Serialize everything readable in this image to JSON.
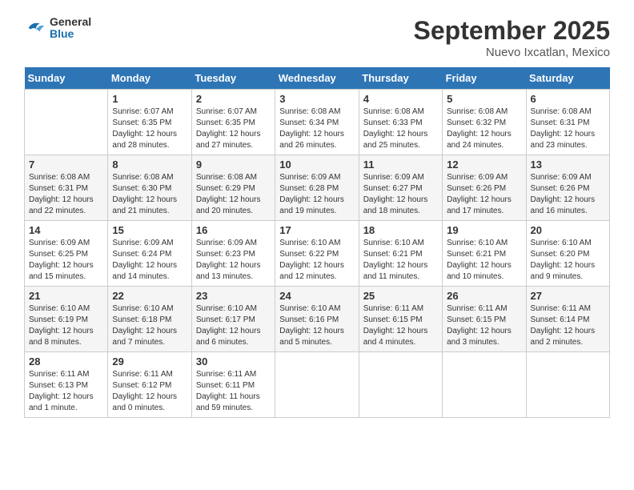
{
  "header": {
    "title": "September 2025",
    "subtitle": "Nuevo Ixcatlan, Mexico",
    "logo_general": "General",
    "logo_blue": "Blue"
  },
  "days_of_week": [
    "Sunday",
    "Monday",
    "Tuesday",
    "Wednesday",
    "Thursday",
    "Friday",
    "Saturday"
  ],
  "weeks": [
    [
      {
        "num": "",
        "info": ""
      },
      {
        "num": "1",
        "info": "Sunrise: 6:07 AM\nSunset: 6:35 PM\nDaylight: 12 hours\nand 28 minutes."
      },
      {
        "num": "2",
        "info": "Sunrise: 6:07 AM\nSunset: 6:35 PM\nDaylight: 12 hours\nand 27 minutes."
      },
      {
        "num": "3",
        "info": "Sunrise: 6:08 AM\nSunset: 6:34 PM\nDaylight: 12 hours\nand 26 minutes."
      },
      {
        "num": "4",
        "info": "Sunrise: 6:08 AM\nSunset: 6:33 PM\nDaylight: 12 hours\nand 25 minutes."
      },
      {
        "num": "5",
        "info": "Sunrise: 6:08 AM\nSunset: 6:32 PM\nDaylight: 12 hours\nand 24 minutes."
      },
      {
        "num": "6",
        "info": "Sunrise: 6:08 AM\nSunset: 6:31 PM\nDaylight: 12 hours\nand 23 minutes."
      }
    ],
    [
      {
        "num": "7",
        "info": "Sunrise: 6:08 AM\nSunset: 6:31 PM\nDaylight: 12 hours\nand 22 minutes."
      },
      {
        "num": "8",
        "info": "Sunrise: 6:08 AM\nSunset: 6:30 PM\nDaylight: 12 hours\nand 21 minutes."
      },
      {
        "num": "9",
        "info": "Sunrise: 6:08 AM\nSunset: 6:29 PM\nDaylight: 12 hours\nand 20 minutes."
      },
      {
        "num": "10",
        "info": "Sunrise: 6:09 AM\nSunset: 6:28 PM\nDaylight: 12 hours\nand 19 minutes."
      },
      {
        "num": "11",
        "info": "Sunrise: 6:09 AM\nSunset: 6:27 PM\nDaylight: 12 hours\nand 18 minutes."
      },
      {
        "num": "12",
        "info": "Sunrise: 6:09 AM\nSunset: 6:26 PM\nDaylight: 12 hours\nand 17 minutes."
      },
      {
        "num": "13",
        "info": "Sunrise: 6:09 AM\nSunset: 6:26 PM\nDaylight: 12 hours\nand 16 minutes."
      }
    ],
    [
      {
        "num": "14",
        "info": "Sunrise: 6:09 AM\nSunset: 6:25 PM\nDaylight: 12 hours\nand 15 minutes."
      },
      {
        "num": "15",
        "info": "Sunrise: 6:09 AM\nSunset: 6:24 PM\nDaylight: 12 hours\nand 14 minutes."
      },
      {
        "num": "16",
        "info": "Sunrise: 6:09 AM\nSunset: 6:23 PM\nDaylight: 12 hours\nand 13 minutes."
      },
      {
        "num": "17",
        "info": "Sunrise: 6:10 AM\nSunset: 6:22 PM\nDaylight: 12 hours\nand 12 minutes."
      },
      {
        "num": "18",
        "info": "Sunrise: 6:10 AM\nSunset: 6:21 PM\nDaylight: 12 hours\nand 11 minutes."
      },
      {
        "num": "19",
        "info": "Sunrise: 6:10 AM\nSunset: 6:21 PM\nDaylight: 12 hours\nand 10 minutes."
      },
      {
        "num": "20",
        "info": "Sunrise: 6:10 AM\nSunset: 6:20 PM\nDaylight: 12 hours\nand 9 minutes."
      }
    ],
    [
      {
        "num": "21",
        "info": "Sunrise: 6:10 AM\nSunset: 6:19 PM\nDaylight: 12 hours\nand 8 minutes."
      },
      {
        "num": "22",
        "info": "Sunrise: 6:10 AM\nSunset: 6:18 PM\nDaylight: 12 hours\nand 7 minutes."
      },
      {
        "num": "23",
        "info": "Sunrise: 6:10 AM\nSunset: 6:17 PM\nDaylight: 12 hours\nand 6 minutes."
      },
      {
        "num": "24",
        "info": "Sunrise: 6:10 AM\nSunset: 6:16 PM\nDaylight: 12 hours\nand 5 minutes."
      },
      {
        "num": "25",
        "info": "Sunrise: 6:11 AM\nSunset: 6:15 PM\nDaylight: 12 hours\nand 4 minutes."
      },
      {
        "num": "26",
        "info": "Sunrise: 6:11 AM\nSunset: 6:15 PM\nDaylight: 12 hours\nand 3 minutes."
      },
      {
        "num": "27",
        "info": "Sunrise: 6:11 AM\nSunset: 6:14 PM\nDaylight: 12 hours\nand 2 minutes."
      }
    ],
    [
      {
        "num": "28",
        "info": "Sunrise: 6:11 AM\nSunset: 6:13 PM\nDaylight: 12 hours\nand 1 minute."
      },
      {
        "num": "29",
        "info": "Sunrise: 6:11 AM\nSunset: 6:12 PM\nDaylight: 12 hours\nand 0 minutes."
      },
      {
        "num": "30",
        "info": "Sunrise: 6:11 AM\nSunset: 6:11 PM\nDaylight: 11 hours\nand 59 minutes."
      },
      {
        "num": "",
        "info": ""
      },
      {
        "num": "",
        "info": ""
      },
      {
        "num": "",
        "info": ""
      },
      {
        "num": "",
        "info": ""
      }
    ]
  ]
}
